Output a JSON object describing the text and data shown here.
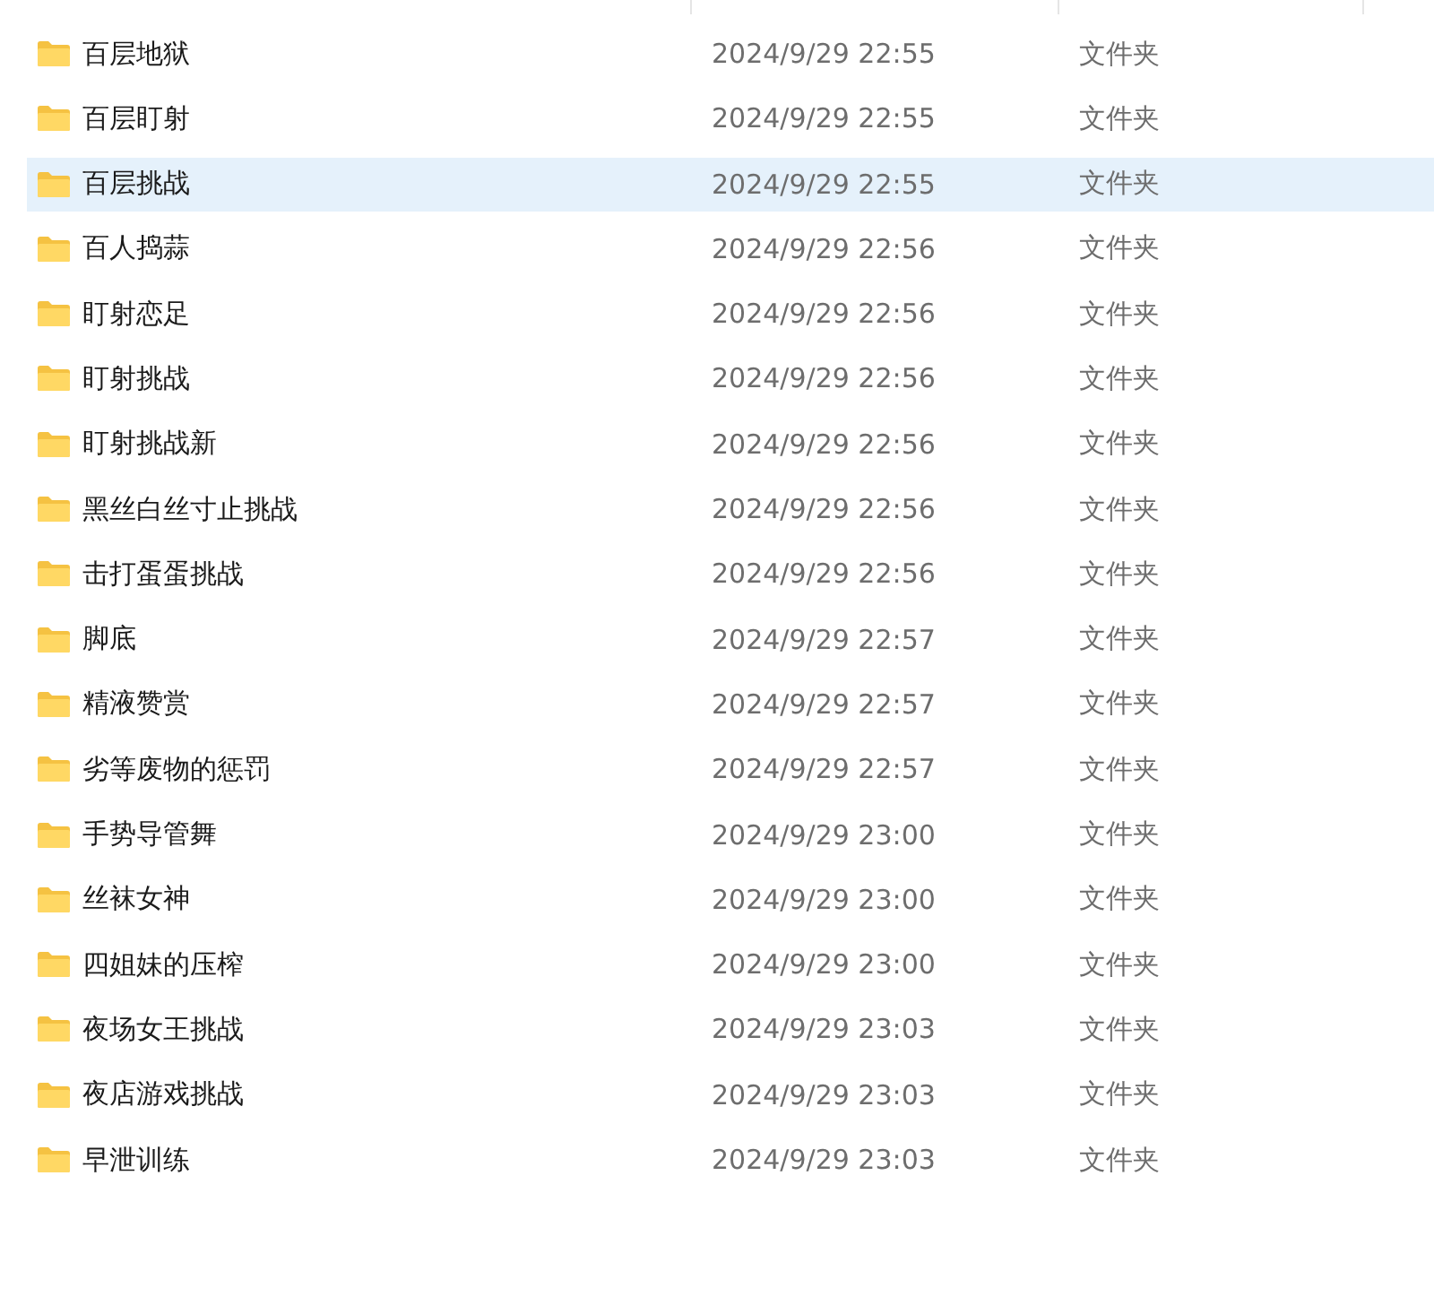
{
  "files": [
    {
      "name": "百层地狱",
      "modified": "2024/9/29 22:55",
      "type": "文件夹",
      "selected": false
    },
    {
      "name": "百层盯射",
      "modified": "2024/9/29 22:55",
      "type": "文件夹",
      "selected": false
    },
    {
      "name": "百层挑战",
      "modified": "2024/9/29 22:55",
      "type": "文件夹",
      "selected": true
    },
    {
      "name": "百人捣蒜",
      "modified": "2024/9/29 22:56",
      "type": "文件夹",
      "selected": false
    },
    {
      "name": "盯射恋足",
      "modified": "2024/9/29 22:56",
      "type": "文件夹",
      "selected": false
    },
    {
      "name": "盯射挑战",
      "modified": "2024/9/29 22:56",
      "type": "文件夹",
      "selected": false
    },
    {
      "name": "盯射挑战新",
      "modified": "2024/9/29 22:56",
      "type": "文件夹",
      "selected": false
    },
    {
      "name": "黑丝白丝寸止挑战",
      "modified": "2024/9/29 22:56",
      "type": "文件夹",
      "selected": false
    },
    {
      "name": "击打蛋蛋挑战",
      "modified": "2024/9/29 22:56",
      "type": "文件夹",
      "selected": false
    },
    {
      "name": "脚底",
      "modified": "2024/9/29 22:57",
      "type": "文件夹",
      "selected": false
    },
    {
      "name": "精液赞赏",
      "modified": "2024/9/29 22:57",
      "type": "文件夹",
      "selected": false
    },
    {
      "name": "劣等废物的惩罚",
      "modified": "2024/9/29 22:57",
      "type": "文件夹",
      "selected": false
    },
    {
      "name": "手势导管舞",
      "modified": "2024/9/29 23:00",
      "type": "文件夹",
      "selected": false
    },
    {
      "name": "丝袜女神",
      "modified": "2024/9/29 23:00",
      "type": "文件夹",
      "selected": false
    },
    {
      "name": "四姐妹的压榨",
      "modified": "2024/9/29 23:00",
      "type": "文件夹",
      "selected": false
    },
    {
      "name": "夜场女王挑战",
      "modified": "2024/9/29 23:03",
      "type": "文件夹",
      "selected": false
    },
    {
      "name": "夜店游戏挑战",
      "modified": "2024/9/29 23:03",
      "type": "文件夹",
      "selected": false
    },
    {
      "name": "早泄训练",
      "modified": "2024/9/29 23:03",
      "type": "文件夹",
      "selected": false
    }
  ]
}
